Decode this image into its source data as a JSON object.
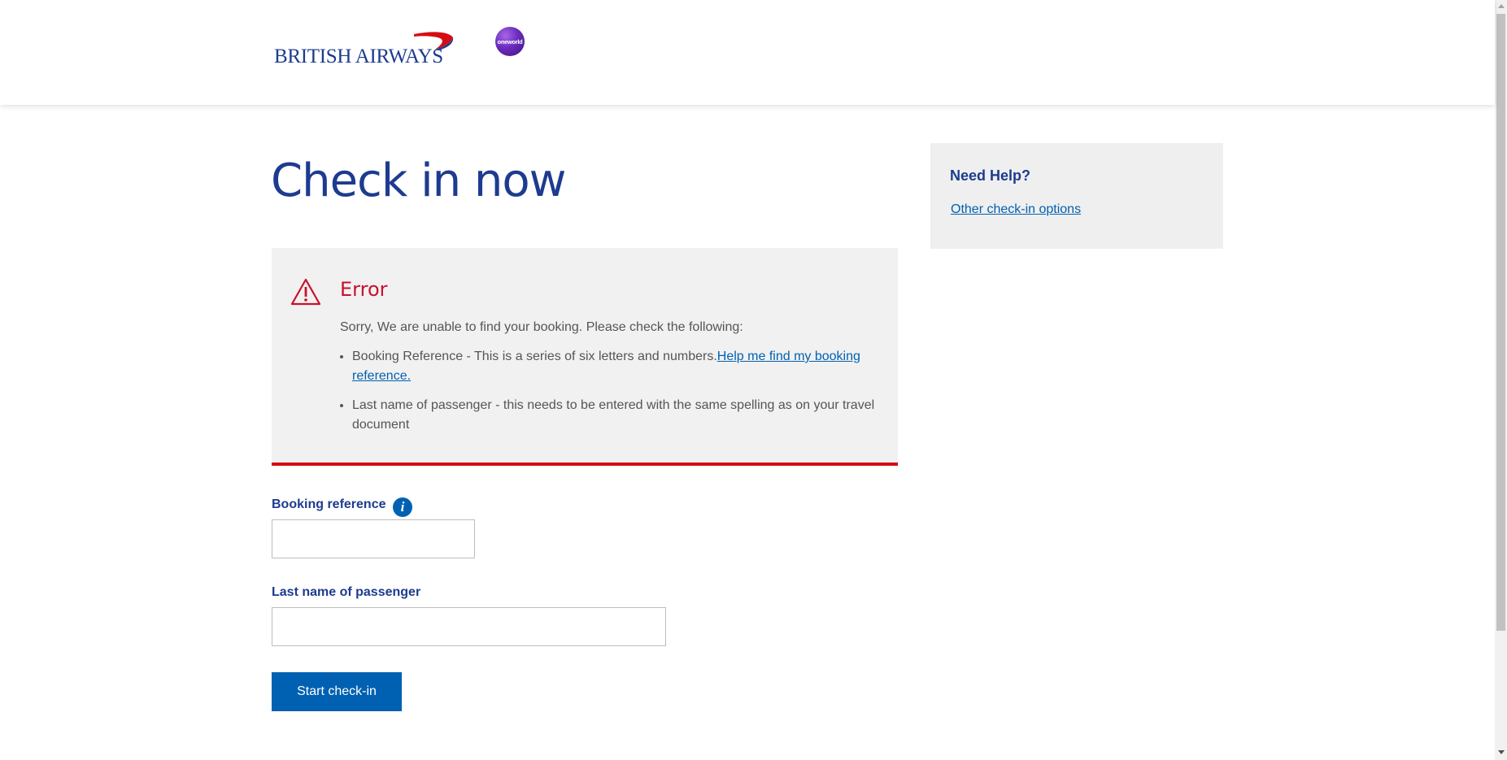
{
  "header": {
    "brand_name": "BRITISH AIRWAYS",
    "partner_badge": "oneworld",
    "colors": {
      "brand_blue": "#1d3b8f",
      "brand_red": "#d40d12",
      "oneworld_purple": "#6b2bbd"
    }
  },
  "main": {
    "title": "Check in now",
    "error": {
      "icon": "warning-triangle-icon",
      "title": "Error",
      "intro": "Sorry, We are unable to find your booking. Please check the following:",
      "items": [
        {
          "text": "Booking Reference - This is a series of six letters and numbers.",
          "link": "Help me find my booking reference."
        },
        {
          "text": "Last name of passenger - this needs to be entered with the same spelling as on your travel document"
        }
      ],
      "colors": {
        "accent": "#d40d12",
        "background": "#f1f1f1"
      }
    },
    "form": {
      "booking_reference": {
        "label": "Booking reference",
        "value": "",
        "info_icon": "info-icon"
      },
      "last_name": {
        "label": "Last name of passenger",
        "value": ""
      },
      "submit_label": "Start check-in",
      "colors": {
        "button": "#0061b2"
      }
    }
  },
  "help": {
    "title": "Need Help?",
    "link": "Other check-in options"
  }
}
